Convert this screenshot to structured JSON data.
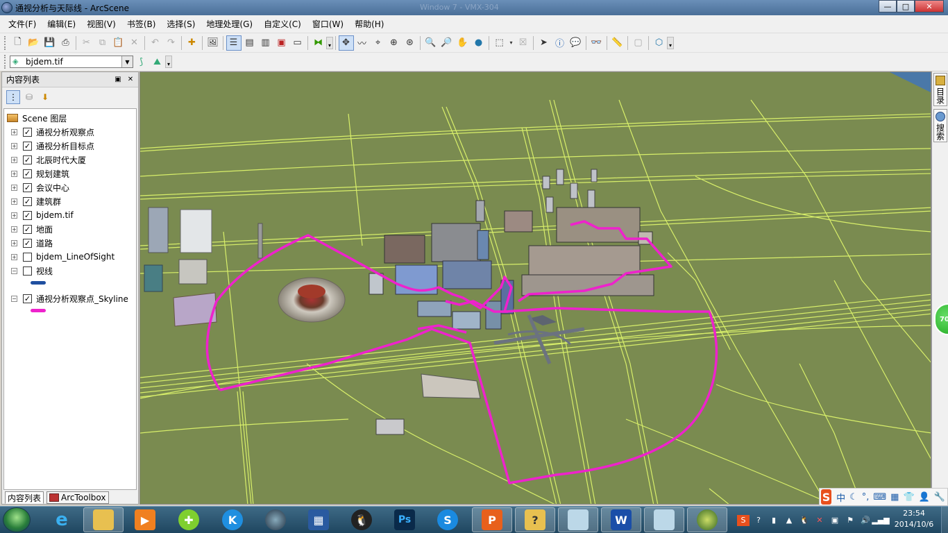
{
  "window": {
    "title": "通视分析与天际线 - ArcScene",
    "ghost_title": "Window 7 - VMX-304",
    "controls": {
      "minimize": "—",
      "maximize": "□",
      "close": "✕"
    }
  },
  "menubar": {
    "items": [
      "文件(F)",
      "编辑(E)",
      "视图(V)",
      "书签(B)",
      "选择(S)",
      "地理处理(G)",
      "自定义(C)",
      "窗口(W)",
      "帮助(H)"
    ]
  },
  "toolbar2": {
    "layer_selector_value": "bjdem.tif"
  },
  "toc": {
    "title": "内容列表",
    "pin": "▣",
    "close": "✕",
    "root_label": "Scene 图层",
    "layers": [
      {
        "label": "通视分析观察点",
        "expander": "+",
        "checked": "✓"
      },
      {
        "label": "通视分析目标点",
        "expander": "+",
        "checked": "✓"
      },
      {
        "label": "北辰时代大厦",
        "expander": "+",
        "checked": "✓"
      },
      {
        "label": "规划建筑",
        "expander": "+",
        "checked": "✓"
      },
      {
        "label": "会议中心",
        "expander": "+",
        "checked": "✓"
      },
      {
        "label": "建筑群",
        "expander": "+",
        "checked": "✓"
      },
      {
        "label": "bjdem.tif",
        "expander": "+",
        "checked": "✓"
      },
      {
        "label": "地面",
        "expander": "+",
        "checked": "✓"
      },
      {
        "label": "道路",
        "expander": "+",
        "checked": "✓"
      },
      {
        "label": "bjdem_LineOfSight",
        "expander": "+",
        "checked": ""
      },
      {
        "label": "视线",
        "expander": "−",
        "checked": ""
      },
      {
        "label": "通视分析观察点_Skyline",
        "expander": "−",
        "checked": "✓"
      }
    ],
    "legend_colors": {
      "sight_line": "#1f4fa0",
      "skyline": "#ee22cc"
    },
    "tabs": [
      "内容列表",
      "ArcToolbox"
    ]
  },
  "right_dock": {
    "tabs": [
      "目录",
      "搜索"
    ],
    "badge": "70"
  },
  "ime": {
    "logo": "S",
    "mode": "中"
  },
  "taskbar": {
    "clock_time": "23:54",
    "clock_date": "2014/10/6",
    "ps_label": "Ps",
    "word_label": "W",
    "ppt_label": "P"
  },
  "colors": {
    "terrain": "#7a8b50",
    "roads": "#d8ef6a",
    "skyline": "#ee22cc"
  }
}
